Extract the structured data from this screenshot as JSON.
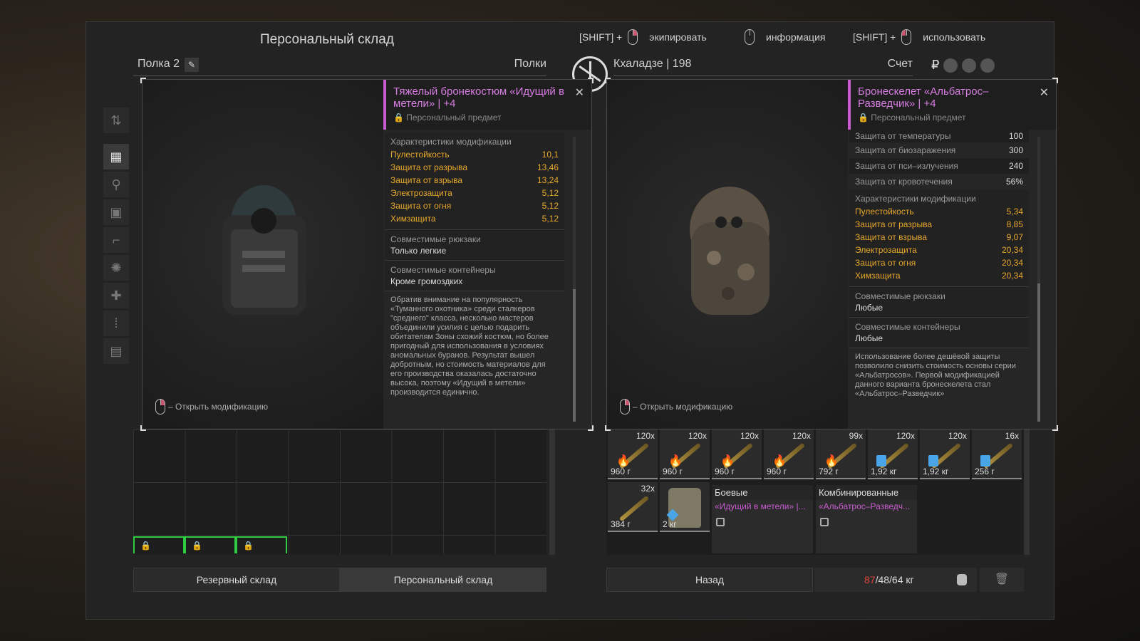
{
  "window": {
    "title": "Персональный склад"
  },
  "hints": [
    {
      "prefix": "[SHIFT] +",
      "label": "экипировать"
    },
    {
      "prefix": "",
      "label": "информация"
    },
    {
      "prefix": "[SHIFT] +",
      "label": "использовать"
    }
  ],
  "shelf": {
    "label": "Полка 2",
    "shelves_label": "Полки"
  },
  "owner": {
    "name": "Кхаладзе | 198",
    "account_label": "Счет",
    "currency_symbol": "₽"
  },
  "left_popup": {
    "name": "Тяжелый бронекостюм «Идущий в метели» | +4",
    "subtitle": "Персональный предмет",
    "close": "✕",
    "open_mod": "– Открыть модификацию",
    "mods_caption": "Характеристики модификации",
    "mods": [
      {
        "name": "Пулестойкость",
        "value": "10,1"
      },
      {
        "name": "Защита от разрыва",
        "value": "13,46"
      },
      {
        "name": "Защита от взрыва",
        "value": "13,24"
      },
      {
        "name": "Электрозащита",
        "value": "5,12"
      },
      {
        "name": "Защита от огня",
        "value": "5,12"
      },
      {
        "name": "Химзащита",
        "value": "5,12"
      }
    ],
    "backpacks_caption": "Совместимые рюкзаки",
    "backpacks_value": "Только легкие",
    "containers_caption": "Совместимые контейнеры",
    "containers_value": "Кроме громоздких",
    "description": "Обратив внимание на популярность «Туманного охотника» среди сталкеров \"среднего\" класса, несколько мастеров объединили усилия с целью подарить обитателям Зоны схожий костюм, но более пригодный для использования в условиях аномальных буранов. Результат вышел добротным, но стоимость материалов для его производства оказалась достаточно высока, поэтому «Идущий в метели» производится единично."
  },
  "right_popup": {
    "name": "Бронескелет «Альбатрос–Разведчик» | +4",
    "subtitle": "Персональный предмет",
    "close": "✕",
    "open_mod": "– Открыть модификацию",
    "stats": [
      {
        "name": "Защита от температуры",
        "value": "100"
      },
      {
        "name": "Защита от биозаражения",
        "value": "300"
      },
      {
        "name": "Защита от пси–излучения",
        "value": "240"
      },
      {
        "name": "Защита от кровотечения",
        "value": "56%"
      }
    ],
    "mods_caption": "Характеристики модификации",
    "mods": [
      {
        "name": "Пулестойкость",
        "value": "5,34"
      },
      {
        "name": "Защита от разрыва",
        "value": "8,85"
      },
      {
        "name": "Защита от взрыва",
        "value": "9,07"
      },
      {
        "name": "Электрозащита",
        "value": "20,34"
      },
      {
        "name": "Защита от огня",
        "value": "20,34"
      },
      {
        "name": "Химзащита",
        "value": "20,34"
      }
    ],
    "backpacks_caption": "Совместимые рюкзаки",
    "backpacks_value": "Любые",
    "containers_caption": "Совместимые контейнеры",
    "containers_value": "Любые",
    "description": "Использование более дешёвой защиты позволило снизить стоимость основы серии «Альбатросов». Первой модификацией данного варианта бронескелета стал «Альбатрос–Разведчик»"
  },
  "items_row1": [
    {
      "count": "120x",
      "weight": "960 г",
      "badge": "fire"
    },
    {
      "count": "120x",
      "weight": "960 г",
      "badge": "fire"
    },
    {
      "count": "120x",
      "weight": "960 г",
      "badge": "fire"
    },
    {
      "count": "120x",
      "weight": "960 г",
      "badge": "fire"
    },
    {
      "count": "99x",
      "weight": "792 г",
      "badge": "fire"
    },
    {
      "count": "120x",
      "weight": "1,92 кг",
      "badge": "shield"
    },
    {
      "count": "120x",
      "weight": "1,92 кг",
      "badge": "shield"
    },
    {
      "count": "16x",
      "weight": "256 г",
      "badge": "shield"
    }
  ],
  "items_row2": [
    {
      "count": "32x",
      "weight": "384 г"
    },
    {
      "count": "",
      "weight": "2 кг"
    }
  ],
  "big_items": [
    {
      "header": "Боевые",
      "name": "«Идущий в метели» |..."
    },
    {
      "header": "Комбинированные",
      "name": "«Альбатрос–Разведч..."
    }
  ],
  "tabs": {
    "reserve": "Резервный склад",
    "personal": "Персональный склад"
  },
  "lower": {
    "back": "Назад",
    "weight_current": "87",
    "weight_rest": "/48/64 кг"
  },
  "colors": {
    "accent": "#c85bd0",
    "gold": "#e6a82c",
    "over_weight": "#e0443a",
    "slot_green": "#2ecc40"
  }
}
